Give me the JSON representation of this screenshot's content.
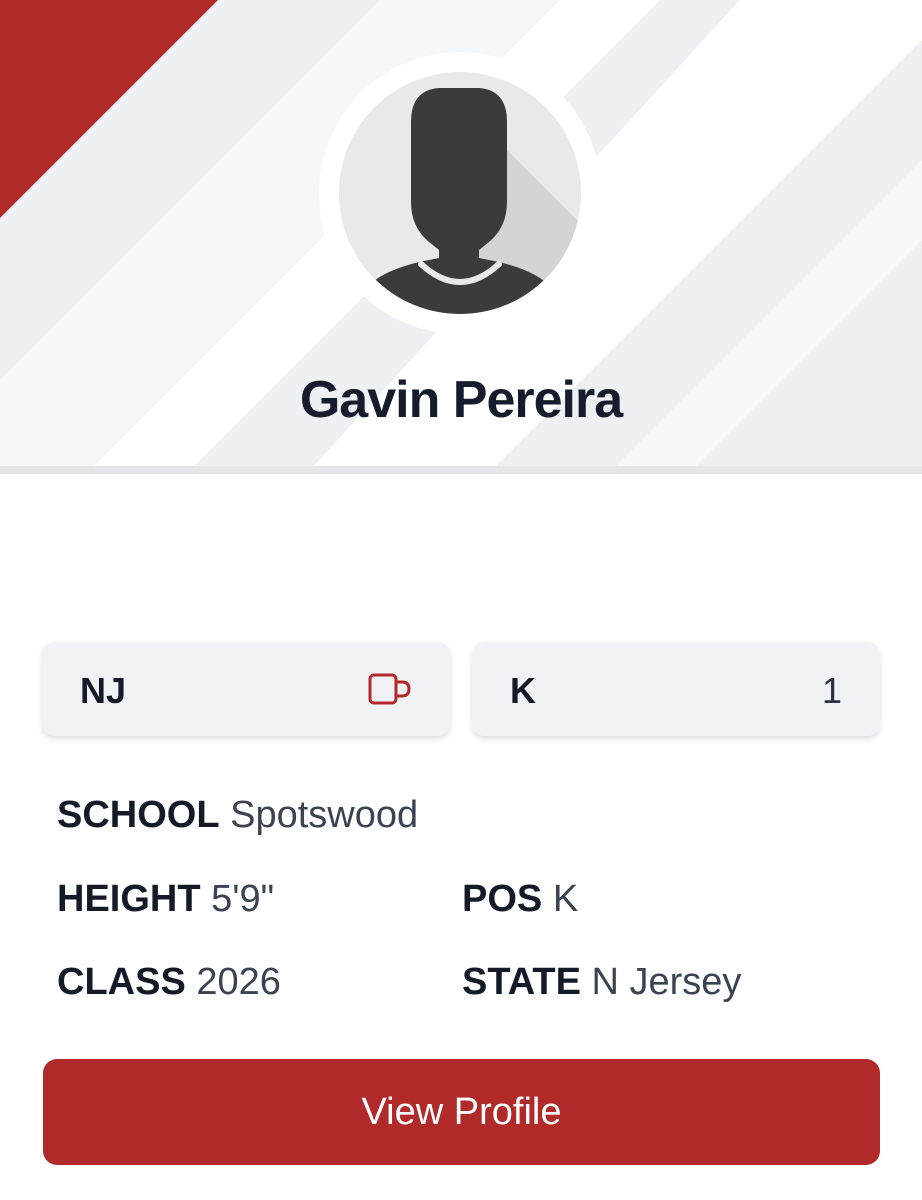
{
  "player": {
    "name": "Gavin Pereira",
    "avatar_icon": "person-silhouette-icon"
  },
  "chips": {
    "state_abbr": "NJ",
    "state_icon": "mug-icon",
    "position": "K",
    "position_count": "1"
  },
  "details": {
    "school_label": "SCHOOL",
    "school_value": "Spotswood",
    "height_label": "HEIGHT",
    "height_value": "5'9\"",
    "pos_label": "POS",
    "pos_value": "K",
    "class_label": "CLASS",
    "class_value": "2026",
    "state_label": "STATE",
    "state_value": "N Jersey"
  },
  "actions": {
    "view_profile": "View Profile"
  },
  "colors": {
    "accent": "#b02a29",
    "hero_background": "#eef0f3",
    "chip_background": "#f1f2f5",
    "text_dark": "#141a28"
  }
}
